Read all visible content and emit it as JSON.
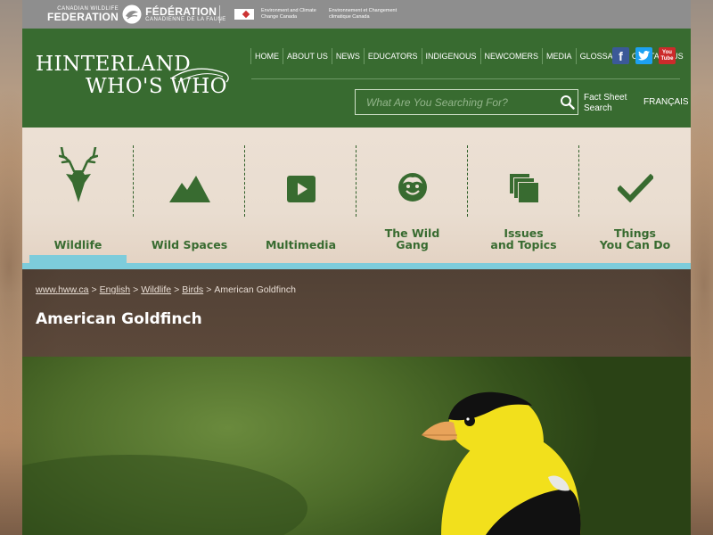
{
  "partners": {
    "cwf_small": "CANADIAN WILDLIFE",
    "cwf_big": "FEDERATION",
    "fcf_big": "FÉDÉRATION",
    "fcf_small": "CANADIENNE DE LA FAUNE",
    "eccc_en": "Environment and Climate Change Canada",
    "eccc_fr": "Environnement et Changement climatique Canada"
  },
  "logo": {
    "line1": "HINTERLAND",
    "line2": "WHO'S WHO"
  },
  "topnav": [
    "HOME",
    "ABOUT US",
    "NEWS",
    "EDUCATORS",
    "INDIGENOUS",
    "NEWCOMERS",
    "MEDIA",
    "GLOSSARY",
    "CONTACT US"
  ],
  "social": {
    "facebook": "f",
    "twitter": "t",
    "youtube_top": "You",
    "youtube_bottom": "Tube"
  },
  "search": {
    "placeholder": "What Are You Searching For?",
    "factsheet_line1": "Fact Sheet",
    "factsheet_line2": "Search",
    "language": "FRANÇAIS"
  },
  "categories": [
    {
      "line1": "Wildlife",
      "line2": "",
      "icon": "deer-icon",
      "active": true
    },
    {
      "line1": "Wild Spaces",
      "line2": "",
      "icon": "mountain-icon"
    },
    {
      "line1": "Multimedia",
      "line2": "",
      "icon": "play-icon"
    },
    {
      "line1": "The Wild",
      "line2": "Gang",
      "icon": "face-icon"
    },
    {
      "line1": "Issues",
      "line2": "and Topics",
      "icon": "pages-icon"
    },
    {
      "line1": "Things",
      "line2": "You Can Do",
      "icon": "checkmark-icon"
    }
  ],
  "breadcrumb": {
    "home": "www.hww.ca",
    "lang": "English",
    "section": "Wildlife",
    "group": "Birds",
    "current": "American Goldfinch",
    "separator": ">"
  },
  "page_title": "American Goldfinch",
  "colors": {
    "header_green": "#386b30",
    "accent_blue": "#7dccdb",
    "goldfinch_yellow": "#f2e01c"
  }
}
